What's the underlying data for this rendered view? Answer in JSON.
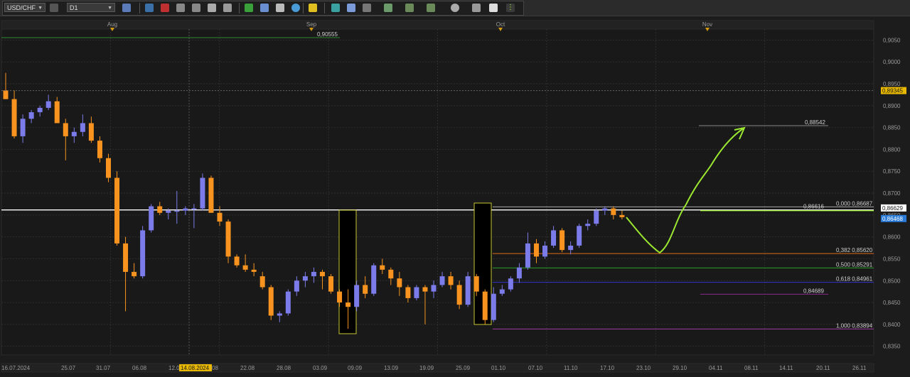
{
  "toolbar": {
    "symbol": "USD/CHF",
    "timeframe": "D1",
    "icons": [
      "link-icon",
      "chart-type-icon",
      "crosshair-icon",
      "line-color-icon",
      "level-icon",
      "zoom-in-icon",
      "zoom-out-icon",
      "cursor-icon",
      "dot-icon",
      "trend-line-icon",
      "template-icon",
      "objects-icon",
      "globe-icon",
      "pencil-icon",
      "indicators-icon",
      "screen-icon",
      "ruler-icon",
      "grid-icon",
      "fan-icon",
      "line-tool-icon",
      "circle-tool-icon",
      "label-icon",
      "eraser-icon",
      "more-icon"
    ]
  },
  "colors": {
    "bull": "#7b7bea",
    "bear": "#f7931e",
    "accent_green": "#9ae630",
    "grid": "#2e2e2e",
    "axis_text": "#9a9a9a",
    "highlight_date": "#e8b800"
  },
  "chart_data": {
    "type": "candlestick",
    "instrument": "USD/CHF",
    "timeframe": "D1",
    "ylim": [
      0.833,
      0.9075
    ],
    "y_ticks": [
      "0,9050",
      "0,9000",
      "0,8950",
      "0,8900",
      "0,8850",
      "0,8800",
      "0,8750",
      "0,8700",
      "0,8650",
      "0,8600",
      "0,8550",
      "0,8500",
      "0,8450",
      "0,8400",
      "0,8350"
    ],
    "x_labels": [
      "16.07.2024",
      "25.07",
      "31.07",
      "06.08",
      "12.08",
      "14.08.2024",
      "22.08",
      "28.08",
      "03.09",
      "09.09",
      "13.09",
      "19.09",
      "25.09",
      "01.10",
      "07.10",
      "11.10",
      "17.10",
      "23.10",
      "29.10",
      "04.11",
      "08.11",
      "14.11",
      "20.11",
      "26.11"
    ],
    "highlighted_date": "14.08.2024",
    "month_markers": [
      "Aug",
      "Sep",
      "Oct",
      "Nov"
    ],
    "candles": [
      [
        0.8935,
        0.8975,
        0.8915,
        0.8915
      ],
      [
        0.8915,
        0.8935,
        0.8825,
        0.883
      ],
      [
        0.883,
        0.888,
        0.8815,
        0.887
      ],
      [
        0.887,
        0.889,
        0.886,
        0.8885
      ],
      [
        0.8885,
        0.89,
        0.8875,
        0.8895
      ],
      [
        0.8895,
        0.8925,
        0.889,
        0.891
      ],
      [
        0.891,
        0.892,
        0.886,
        0.886
      ],
      [
        0.886,
        0.887,
        0.8775,
        0.883
      ],
      [
        0.883,
        0.885,
        0.8815,
        0.884
      ],
      [
        0.884,
        0.888,
        0.883,
        0.886
      ],
      [
        0.886,
        0.8875,
        0.8815,
        0.882
      ],
      [
        0.882,
        0.883,
        0.877,
        0.878
      ],
      [
        0.878,
        0.879,
        0.8725,
        0.8735
      ],
      [
        0.8735,
        0.875,
        0.858,
        0.8585
      ],
      [
        0.8585,
        0.86,
        0.843,
        0.852
      ],
      [
        0.852,
        0.854,
        0.8505,
        0.851
      ],
      [
        0.851,
        0.8625,
        0.8505,
        0.8615
      ],
      [
        0.8615,
        0.8675,
        0.861,
        0.867
      ],
      [
        0.867,
        0.868,
        0.865,
        0.8655
      ],
      [
        0.8655,
        0.8665,
        0.864,
        0.866
      ],
      [
        0.866,
        0.8705,
        0.863,
        0.866
      ],
      [
        0.866,
        0.867,
        0.865,
        0.8665
      ],
      [
        0.8665,
        0.8675,
        0.862,
        0.8665
      ],
      [
        0.8665,
        0.8745,
        0.866,
        0.8735
      ],
      [
        0.8735,
        0.874,
        0.866,
        0.8655
      ],
      [
        0.8655,
        0.867,
        0.8625,
        0.8635
      ],
      [
        0.8635,
        0.864,
        0.854,
        0.8555
      ],
      [
        0.8555,
        0.856,
        0.853,
        0.8535
      ],
      [
        0.8535,
        0.856,
        0.852,
        0.8525
      ],
      [
        0.8525,
        0.854,
        0.851,
        0.852
      ],
      [
        0.851,
        0.852,
        0.848,
        0.8485
      ],
      [
        0.8485,
        0.849,
        0.841,
        0.842
      ],
      [
        0.842,
        0.843,
        0.8405,
        0.8425
      ],
      [
        0.8425,
        0.848,
        0.842,
        0.8475
      ],
      [
        0.8475,
        0.851,
        0.8465,
        0.85
      ],
      [
        0.85,
        0.852,
        0.8485,
        0.851
      ],
      [
        0.851,
        0.853,
        0.8495,
        0.852
      ],
      [
        0.852,
        0.8525,
        0.848,
        0.851
      ],
      [
        0.851,
        0.8515,
        0.847,
        0.8475
      ],
      [
        0.8475,
        0.848,
        0.844,
        0.845
      ],
      [
        0.845,
        0.848,
        0.839,
        0.844
      ],
      [
        0.844,
        0.85,
        0.843,
        0.849
      ],
      [
        0.849,
        0.851,
        0.846,
        0.847
      ],
      [
        0.847,
        0.854,
        0.8465,
        0.8535
      ],
      [
        0.8535,
        0.855,
        0.8515,
        0.8525
      ],
      [
        0.8525,
        0.853,
        0.849,
        0.8505
      ],
      [
        0.8505,
        0.852,
        0.8465,
        0.8485
      ],
      [
        0.8485,
        0.849,
        0.845,
        0.846
      ],
      [
        0.846,
        0.849,
        0.8455,
        0.8485
      ],
      [
        0.8485,
        0.849,
        0.84,
        0.8475
      ],
      [
        0.8475,
        0.85,
        0.846,
        0.849
      ],
      [
        0.849,
        0.852,
        0.8485,
        0.851
      ],
      [
        0.851,
        0.852,
        0.848,
        0.849
      ],
      [
        0.849,
        0.85,
        0.8435,
        0.8445
      ],
      [
        0.8445,
        0.852,
        0.844,
        0.851
      ],
      [
        0.851,
        0.8515,
        0.8465,
        0.8475
      ],
      [
        0.8475,
        0.848,
        0.84,
        0.841
      ],
      [
        0.841,
        0.8485,
        0.8405,
        0.847
      ],
      [
        0.847,
        0.849,
        0.8465,
        0.848
      ],
      [
        0.848,
        0.851,
        0.8475,
        0.8505
      ],
      [
        0.8505,
        0.854,
        0.8495,
        0.853
      ],
      [
        0.853,
        0.861,
        0.8525,
        0.8585
      ],
      [
        0.8585,
        0.8595,
        0.854,
        0.8555
      ],
      [
        0.8555,
        0.859,
        0.855,
        0.858
      ],
      [
        0.858,
        0.8625,
        0.8575,
        0.8615
      ],
      [
        0.8615,
        0.862,
        0.8565,
        0.857
      ],
      [
        0.857,
        0.859,
        0.856,
        0.858
      ],
      [
        0.858,
        0.863,
        0.8575,
        0.8625
      ],
      [
        0.8625,
        0.864,
        0.8615,
        0.863
      ],
      [
        0.863,
        0.8665,
        0.8625,
        0.866
      ],
      [
        0.866,
        0.867,
        0.865,
        0.8665
      ],
      [
        0.8665,
        0.867,
        0.864,
        0.865
      ],
      [
        0.865,
        0.866,
        0.864,
        0.8645
      ]
    ],
    "horizontal_levels": [
      {
        "label": "0,90555",
        "value": 0.90555
      },
      {
        "label": "0,88542",
        "value": 0.88542
      },
      {
        "label": "0,86616",
        "value": 0.86616
      }
    ],
    "fibonacci": [
      {
        "label": "0,000 0,86687",
        "value": 0.86687
      },
      {
        "label": "0,382 0,85620",
        "value": 0.8562
      },
      {
        "label": "0,500 0,85291",
        "value": 0.85291
      },
      {
        "label": "0,618 0,84961",
        "value": 0.84961
      },
      {
        "label": "0,84689",
        "value": 0.84689
      },
      {
        "label": "1,000 0,83894",
        "value": 0.83894
      }
    ],
    "price_tags": [
      {
        "label": "0,89345",
        "value": 0.89345
      },
      {
        "label": "0,86629",
        "value": 0.86629
      },
      {
        "label": "0,86468",
        "value": 0.86468
      }
    ],
    "grid": true,
    "legend": "none"
  }
}
